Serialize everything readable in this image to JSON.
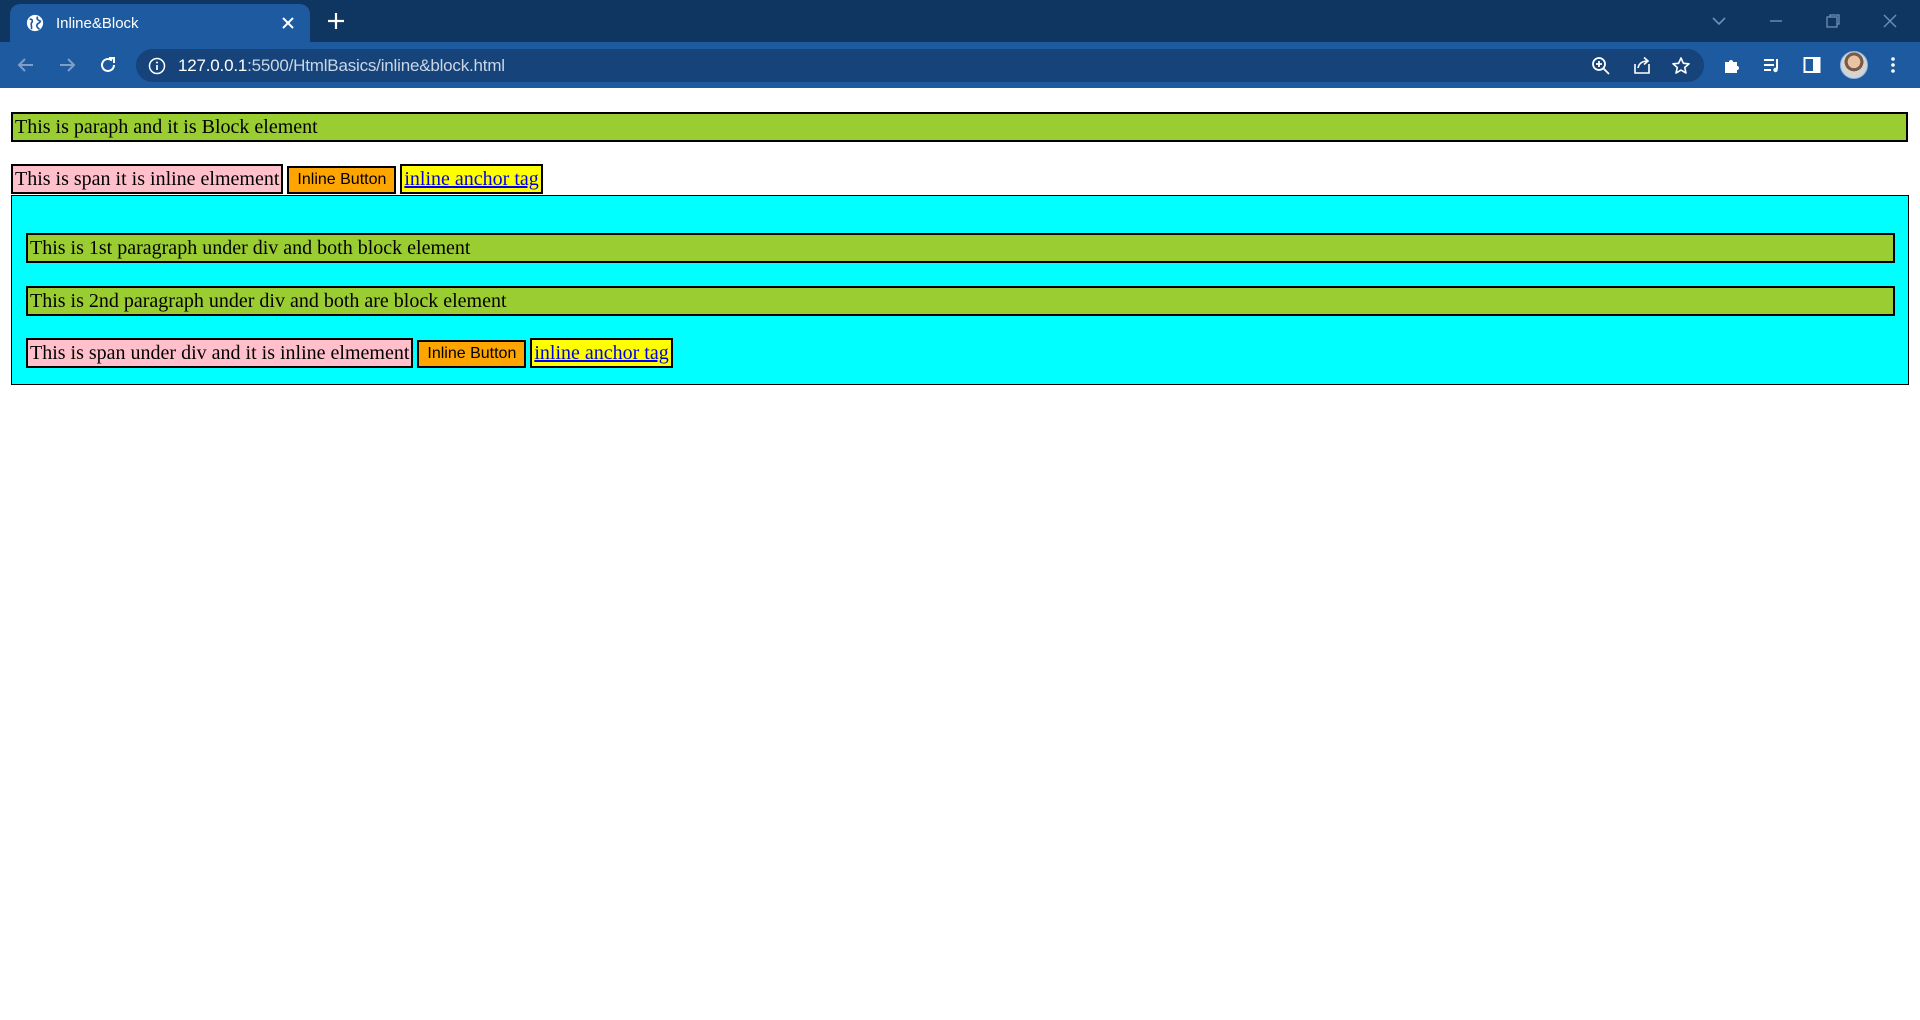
{
  "browser": {
    "tab_title": "Inline&Block",
    "url_host": "127.0.0.1",
    "url_rest": ":5500/HtmlBasics/inline&block.html"
  },
  "page": {
    "block_paragraph": "This is paraph and it is Block element",
    "span_text": "This is span it is inline elmement",
    "button_label": "Inline Button",
    "anchor_text": "inline anchor tag",
    "div": {
      "paragraph_1": "This is 1st paragraph under div and both block element",
      "paragraph_2": "This is 2nd paragraph under div and both are block element",
      "span_text": "This is span under div and it is inline elmement",
      "button_label": "Inline Button",
      "anchor_text": "inline anchor tag"
    }
  },
  "colors": {
    "tabstrip": "#0f3561",
    "toolbar": "#1d5aa0",
    "block": "yellowgreen",
    "span": "pink",
    "button": "orange",
    "anchor": "yellow",
    "div": "cyan"
  }
}
